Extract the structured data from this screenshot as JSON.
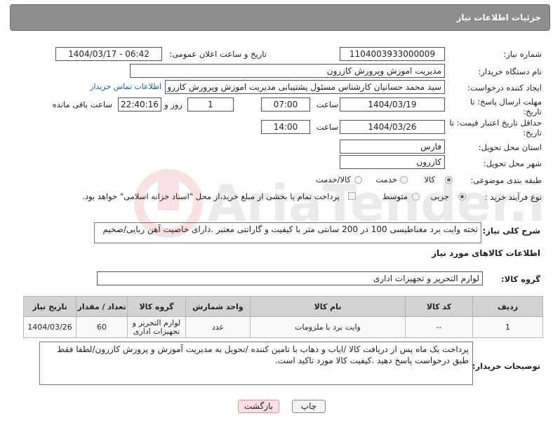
{
  "header": {
    "title": "جزئیات اطلاعات نیاز"
  },
  "fields": {
    "need_number_label": "شماره نیاز:",
    "need_number": "1104003933000009",
    "announce_label": "تاریخ و ساعت اعلان عمومی:",
    "announce_value": "1404/03/17 - 06:42",
    "buyer_org_label": "نام دستگاه خریدار:",
    "buyer_org": "مدیریت اموزش وپرورش کازرون",
    "creator_label": "ایجاد کننده درخواست:",
    "creator": "سید محمد  حسانیان  کارشناس مسئول پشتیبانی مدیریت اموزش وپرورش کازرو",
    "buyer_contact_link": "اطلاعات تماس خریدار",
    "reply_deadline_label": "مهلت ارسال پاسخ: تا تاریخ:",
    "reply_date": "1404/03/19",
    "time_label": "ساعت",
    "reply_time": "07:00",
    "days_value": "1",
    "days_label": "روز و",
    "remaining_time": "22:40:16",
    "remaining_label": "ساعت باقی مانده",
    "price_validity_label": "حداقل تاریخ اعتبار قیمت: تا تاریخ:",
    "price_date": "1404/03/26",
    "price_time": "14:00",
    "province_label": "استان محل تحویل:",
    "province": "فارس",
    "city_label": "شهر محل تحویل:",
    "city": "کازرون",
    "category_label": "طبقه بندی موضوعی:",
    "category_options": [
      "کالا",
      "خدمت",
      "کالا/خدمت"
    ],
    "process_label": "نوع فرآیند خرید :",
    "process_options": [
      "جزیی",
      "متوسط"
    ],
    "payment_note": "پرداخت تمام یا بخشی از مبلغ خرید،از محل \"اسناد خزانه اسلامی\" خواهد بود."
  },
  "description": {
    "label": "شرح کلی نیاز:",
    "text": "تخته وایت برد مغناطیسی 100 در 200 سانتی متر با کیفیت و گارانتی معتبر .دارای خاصیت آهن ربایی/ضخیم"
  },
  "goods_section": {
    "title": "اطلاعات کالاهای مورد نیاز",
    "group_label": "گروه کالا:",
    "group_value": "لوازم التحریر و تجهیزات اداری"
  },
  "table": {
    "headers": [
      "ردیف",
      "کد کالا",
      "نام کالا",
      "واحد شمارش",
      "گروه کالا",
      "تعداد / مقدار",
      "تاریخ نیاز"
    ],
    "rows": [
      {
        "row": "1",
        "code": "--",
        "name": "وایت برد با ملزومات",
        "unit": "عدد",
        "group_line1": "لوازم التحریر و",
        "group_line2": "تجهیزات اداری",
        "qty": "60",
        "date": "1404/03/26"
      }
    ]
  },
  "buyer_notes": {
    "label": "توضیحات خریدار:",
    "text": "پرداخت یک ماه پس از دریافت کالا /ایاب و ذهاب با تامین کننده /تحویل به مدیریت آموزش و پرورش کازرون/لطفا فقط طبق درخواست پاسخ دهید .کیفیت کالا مورد تاکید است."
  },
  "buttons": {
    "print": "چاپ",
    "back": "بازگشت"
  },
  "watermark": "AriaTender.net"
}
